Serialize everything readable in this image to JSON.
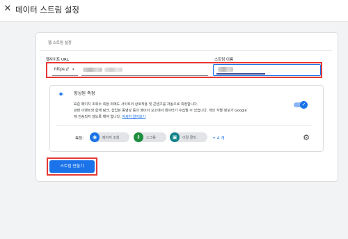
{
  "header": {
    "close_icon": "close-icon",
    "title": "데이터 스트림 설정"
  },
  "stream_card": {
    "title": "웹 스트림 설정",
    "website_url": {
      "label": "웹사이트 URL",
      "protocol_value": "https://",
      "protocol_caret": "▾"
    },
    "stream_name": {
      "label": "스트림 이름"
    }
  },
  "enhanced_measurement": {
    "icon": "sparkle-icon",
    "title": "향상된 측정",
    "description_lines": [
      "표준 페이지 조회수 측정 외에도 사이트의 상호작용 및 콘텐츠를 자동으로 측정합니다.",
      "관련 이벤트와 함께 링크, 삽입된 동영상 등의 페이지 요소에서 데이터가 수집될 수 있습니다. 개인 식별 정보가 Google",
      "에 전송되지 않도록 해야 합니다."
    ],
    "learn_more_link": "자세히 알아보기",
    "toggle_on": true,
    "measuring_label": "측정:",
    "chips": [
      {
        "label": "페이지 조회",
        "icon": "eye-icon",
        "color": "#1a73e8"
      },
      {
        "label": "스크롤",
        "icon": "scroll-arrows-icon",
        "color": "#1e8e3e"
      },
      {
        "label": "이탈 클릭",
        "icon": "lock-icon",
        "color": "#12848a"
      }
    ],
    "more_link": "+ 4 개",
    "settings_icon": "gear-icon"
  },
  "actions": {
    "create_stream_button": "스트림 만들기"
  },
  "colors": {
    "accent": "#1a73e8",
    "highlight_outline": "#e53935"
  }
}
